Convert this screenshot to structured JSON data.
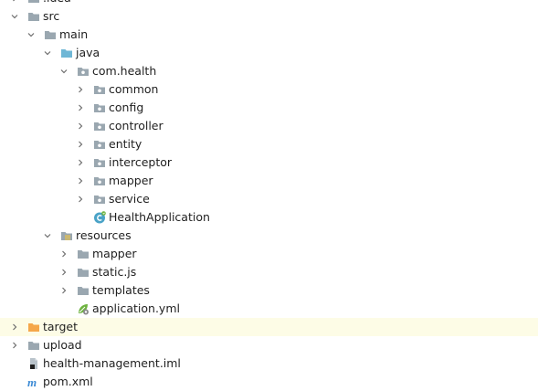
{
  "tree": {
    "rows": [
      {
        "label": ".idea",
        "icon": "folder-gray-icon",
        "chevron": "collapsed"
      },
      {
        "label": "src",
        "icon": "folder-gray-icon",
        "chevron": "expanded"
      },
      {
        "label": "main",
        "icon": "folder-gray-icon",
        "chevron": "expanded"
      },
      {
        "label": "java",
        "icon": "folder-source-blue-icon",
        "chevron": "expanded"
      },
      {
        "label": "com.health",
        "icon": "package-icon",
        "chevron": "expanded"
      },
      {
        "label": "common",
        "icon": "package-icon",
        "chevron": "collapsed"
      },
      {
        "label": "config",
        "icon": "package-icon",
        "chevron": "collapsed"
      },
      {
        "label": "controller",
        "icon": "package-icon",
        "chevron": "collapsed"
      },
      {
        "label": "entity",
        "icon": "package-icon",
        "chevron": "collapsed"
      },
      {
        "label": "interceptor",
        "icon": "package-icon",
        "chevron": "collapsed"
      },
      {
        "label": "mapper",
        "icon": "package-icon",
        "chevron": "collapsed"
      },
      {
        "label": "service",
        "icon": "package-icon",
        "chevron": "collapsed"
      },
      {
        "label": "HealthApplication",
        "icon": "spring-boot-class-icon",
        "chevron": "none"
      },
      {
        "label": "resources",
        "icon": "resources-folder-icon",
        "chevron": "expanded"
      },
      {
        "label": "mapper",
        "icon": "folder-gray-icon",
        "chevron": "collapsed"
      },
      {
        "label": "static.js",
        "icon": "folder-gray-icon",
        "chevron": "collapsed"
      },
      {
        "label": "templates",
        "icon": "folder-gray-icon",
        "chevron": "collapsed"
      },
      {
        "label": "application.yml",
        "icon": "spring-yaml-icon",
        "chevron": "none"
      },
      {
        "label": "target",
        "icon": "folder-orange-icon",
        "chevron": "collapsed",
        "highlighted": true
      },
      {
        "label": "upload",
        "icon": "folder-gray-icon",
        "chevron": "collapsed"
      },
      {
        "label": "health-management.iml",
        "icon": "iml-file-icon",
        "chevron": "none"
      },
      {
        "label": "pom.xml",
        "icon": "maven-icon",
        "chevron": "none"
      }
    ]
  },
  "colors": {
    "highlight_row": "#fdfce6",
    "folder_gray": "#9aa7b0",
    "folder_blue": "#6fb7d6",
    "folder_orange": "#f5a74a",
    "spring_green": "#6db33f",
    "maven_blue": "#3d8bd5"
  }
}
